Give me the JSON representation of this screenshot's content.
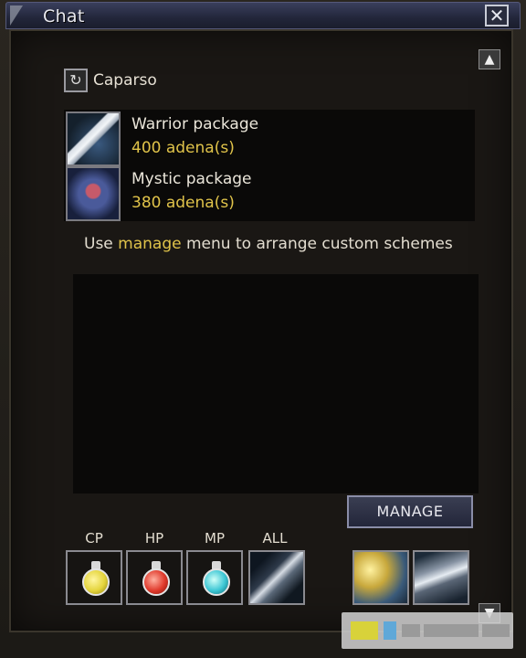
{
  "window": {
    "title": "Chat",
    "close_icon": "✕"
  },
  "npc": {
    "name": "Caparso",
    "icon": "refresh-icon"
  },
  "packages": [
    {
      "name": "Warrior package",
      "price": "400 adena(s)",
      "icon": "sword-icon"
    },
    {
      "name": "Mystic package",
      "price": "380 adena(s)",
      "icon": "mystic-icon"
    }
  ],
  "hint": {
    "before": "Use ",
    "highlight": "manage",
    "after": " menu to arrange custom schemes"
  },
  "manage_button": {
    "label": "MANAGE"
  },
  "buffs": {
    "labels": [
      "CP",
      "HP",
      "MP",
      "ALL"
    ]
  },
  "colors": {
    "highlight": "#e0c34a",
    "text": "#e3ddd0",
    "titlebar": "#2a2e45"
  }
}
